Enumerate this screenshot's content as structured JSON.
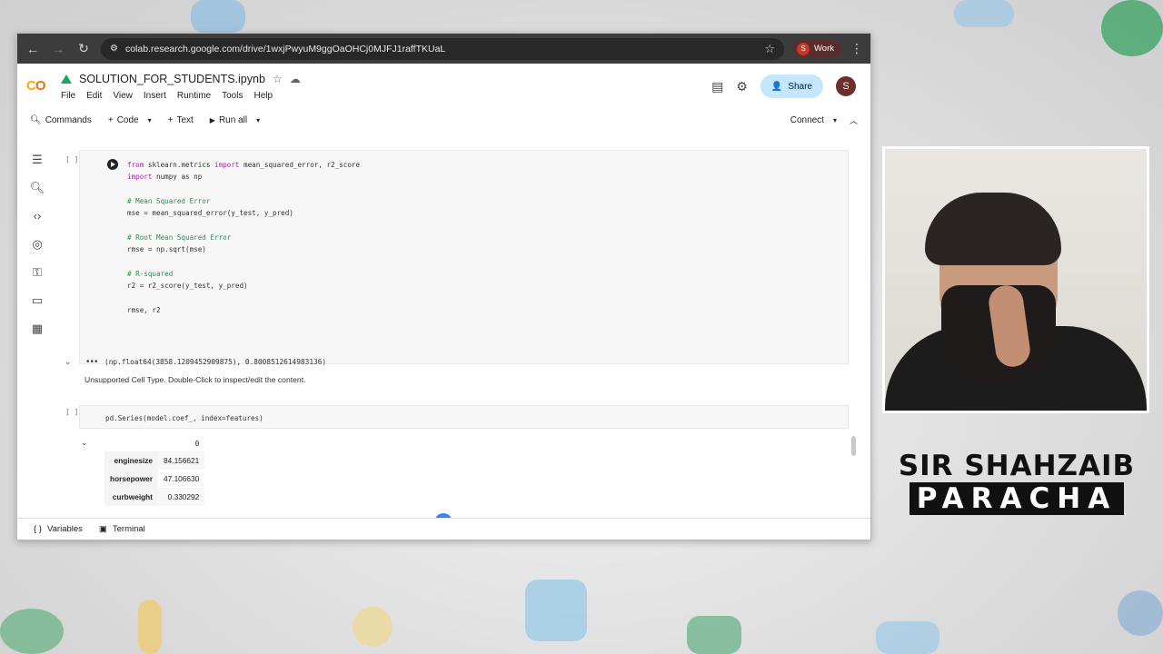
{
  "browser": {
    "url": "colab.research.google.com/drive/1wxjPwyuM9ggOaOHCj0MJFJ1raffTKUaL",
    "profile_initial": "S",
    "profile_label": "Work"
  },
  "notebook": {
    "title": "SOLUTION_FOR_STUDENTS.ipynb",
    "menu": [
      "File",
      "Edit",
      "View",
      "Insert",
      "Runtime",
      "Tools",
      "Help"
    ],
    "share_label": "Share",
    "avatar_initial": "S"
  },
  "toolbar": {
    "commands": "Commands",
    "code": "Code",
    "text": "Text",
    "run_all": "Run all",
    "connect": "Connect"
  },
  "cells": {
    "cell1_bracket": "[ ]",
    "cell1_code": [
      {
        "t": "kw",
        "s": "from"
      },
      {
        "t": "",
        "s": " sklearn.metrics "
      },
      {
        "t": "kw",
        "s": "import"
      },
      {
        "t": "",
        "s": " mean_squared_error, r2_score\n"
      },
      {
        "t": "kw",
        "s": "import"
      },
      {
        "t": "",
        "s": " numpy as np\n\n"
      },
      {
        "t": "cm",
        "s": "# Mean Squared Error\n"
      },
      {
        "t": "",
        "s": "mse = mean_squared_error(y_test, y_pred)\n\n"
      },
      {
        "t": "cm",
        "s": "# Root Mean Squared Error\n"
      },
      {
        "t": "",
        "s": "rmse = np.sqrt(mse)\n\n"
      },
      {
        "t": "cm",
        "s": "# R-squared\n"
      },
      {
        "t": "",
        "s": "r2 = r2_score(y_test, y_pred)\n\n"
      },
      {
        "t": "",
        "s": "rmse, r2"
      }
    ],
    "cell1_output": "(np.float64(3858.1209452909875), 0.8008512614983136)",
    "unsupported_text": "Unsupported Cell Type. Double-Click to inspect/edit the content.",
    "cell2_bracket": "[ ]",
    "cell2_code": "pd.Series(model.coef_, index=features)",
    "series_header": "0",
    "series_rows": [
      {
        "label": "enginesize",
        "value": "84.156621"
      },
      {
        "label": "horsepower",
        "value": "47.106630"
      },
      {
        "label": "curbweight",
        "value": "0.330292"
      }
    ]
  },
  "statusbar": {
    "variables": "Variables",
    "terminal": "Terminal"
  },
  "brand": {
    "line1": "SIR SHAHZAIB",
    "line2": "PARACHA"
  }
}
